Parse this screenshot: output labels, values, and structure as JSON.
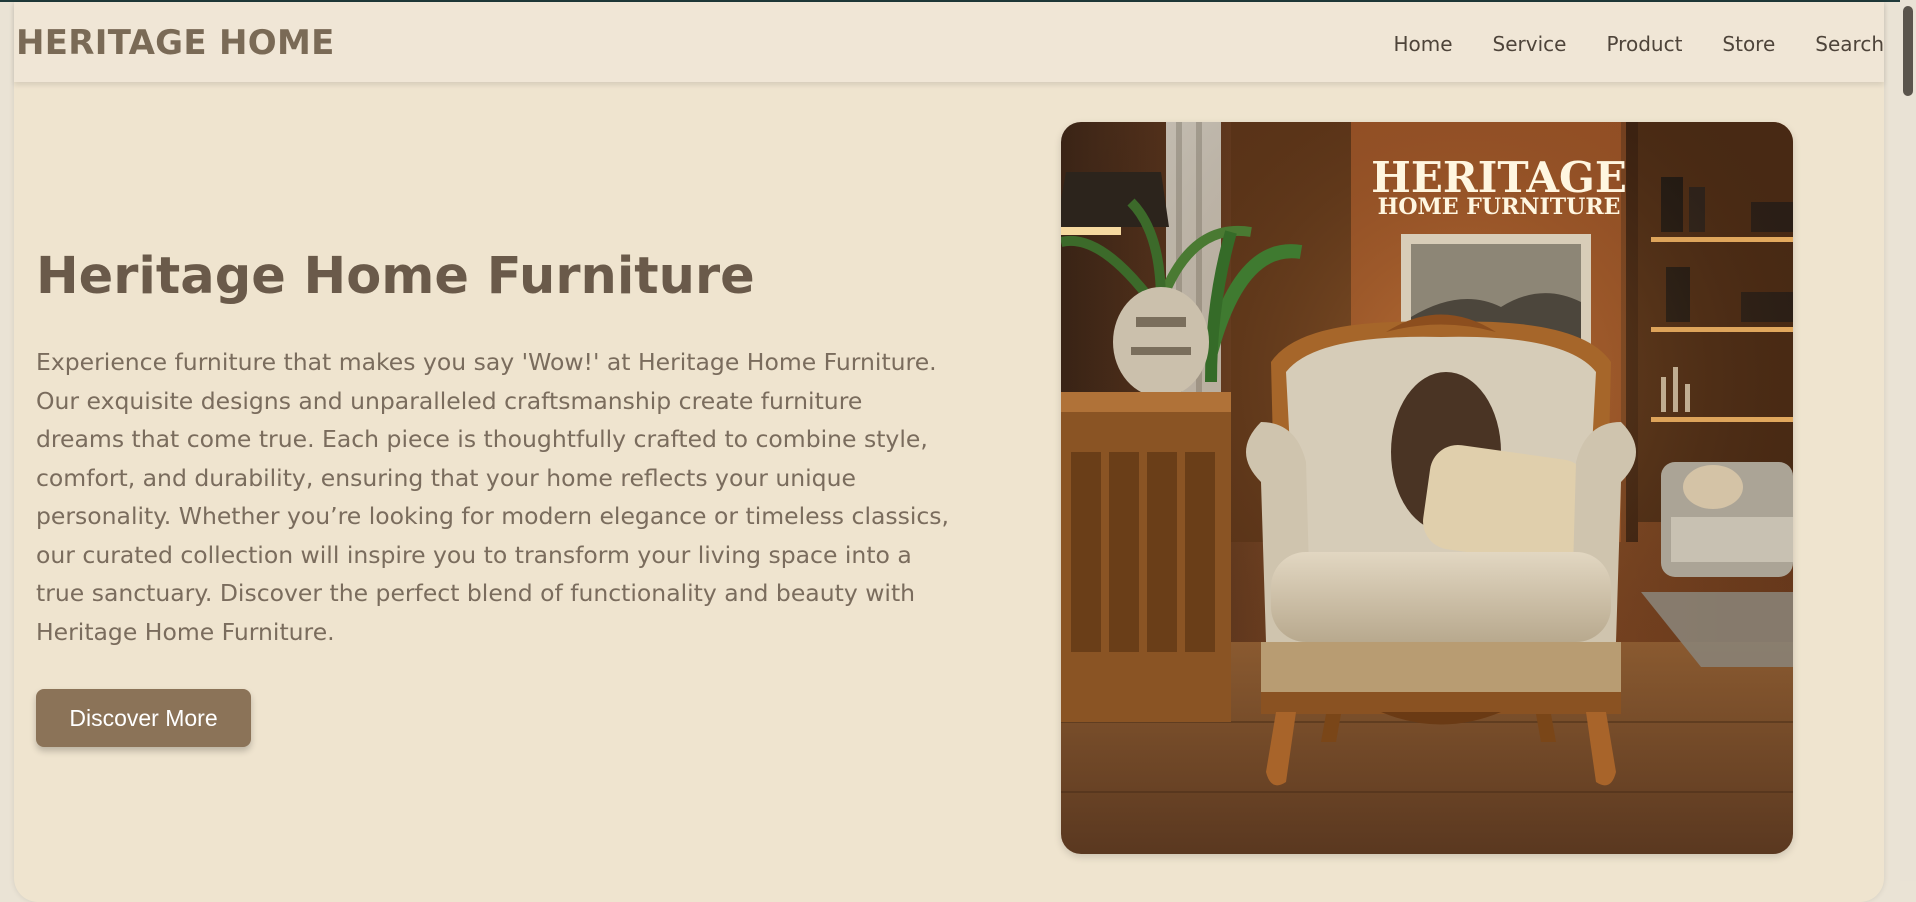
{
  "brand": {
    "logo": "HERITAGE HOME"
  },
  "nav": [
    "Home",
    "Service",
    "Product",
    "Store",
    "Search"
  ],
  "hero": {
    "title": "Heritage Home Furniture",
    "description": "Experience furniture that makes you say 'Wow!' at Heritage Home Furniture. Our exquisite designs and unparalleled craftsmanship create furniture dreams that come true. Each piece is thoughtfully crafted to combine style, comfort, and durability, ensuring that your home reflects your unique personality. Whether you’re looking for modern elegance or timeless classics, our curated collection will inspire you to transform your living space into a true sanctuary. Discover the perfect blend of functionality and beauty with Heritage Home Furniture.",
    "cta": "Discover More"
  },
  "image": {
    "sign_line1": "HERITAGE",
    "sign_line2": "HOME FURNITURE"
  },
  "colors": {
    "background": "#efe4cf",
    "navbar": "#f0e6d6",
    "heading": "#6a5a4a",
    "body_text": "#7a6c5d",
    "button": "#8b7358"
  }
}
